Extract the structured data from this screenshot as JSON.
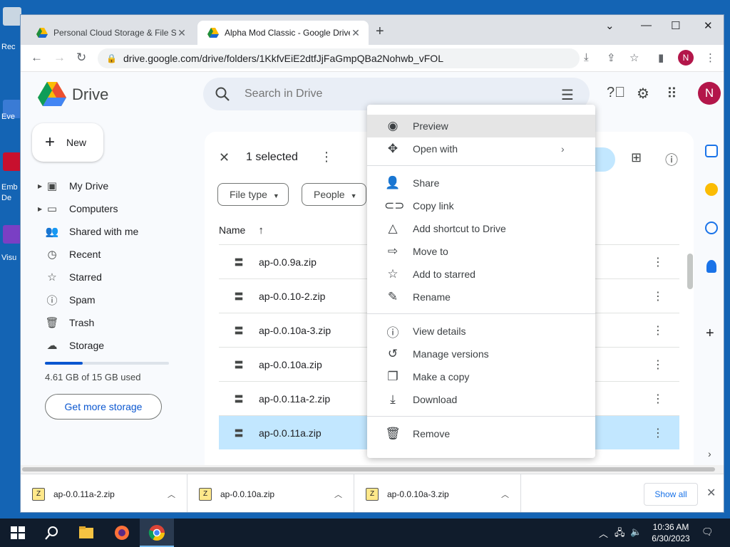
{
  "browser": {
    "tabs": [
      {
        "title": "Personal Cloud Storage & File Sh",
        "active": false
      },
      {
        "title": "Alpha Mod Classic - Google Drive",
        "active": true
      }
    ],
    "url": "drive.google.com/drive/folders/1KkfvEiE2dtfJjFaGmpQBa2Nohwb_vFOL",
    "profile_initial": "N"
  },
  "drive": {
    "app_name": "Drive",
    "search_placeholder": "Search in Drive",
    "new_label": "New",
    "profile_initial": "N",
    "nav": [
      {
        "label": "My Drive",
        "icon": "my-drive-icon",
        "expandable": true
      },
      {
        "label": "Computers",
        "icon": "computer-icon",
        "expandable": true
      },
      {
        "label": "Shared with me",
        "icon": "people-icon",
        "expandable": false
      },
      {
        "label": "Recent",
        "icon": "clock-icon",
        "expandable": false
      },
      {
        "label": "Starred",
        "icon": "star-icon",
        "expandable": false
      },
      {
        "label": "Spam",
        "icon": "spam-icon",
        "expandable": false
      },
      {
        "label": "Trash",
        "icon": "trash-icon",
        "expandable": false
      },
      {
        "label": "Storage",
        "icon": "cloud-icon",
        "expandable": false
      }
    ],
    "storage": {
      "used_text": "4.61 GB of 15 GB used",
      "used_fraction": 0.307,
      "button_label": "Get more storage"
    },
    "selection": {
      "text": "1 selected"
    },
    "filters": [
      "File type",
      "People"
    ],
    "column_name": "Name",
    "files": [
      {
        "name": "ap-0.0.9a.zip",
        "selected": false
      },
      {
        "name": "ap-0.0.10-2.zip",
        "selected": false
      },
      {
        "name": "ap-0.0.10a-3.zip",
        "selected": false
      },
      {
        "name": "ap-0.0.10a.zip",
        "selected": false
      },
      {
        "name": "ap-0.0.11a-2.zip",
        "selected": false
      },
      {
        "name": "ap-0.0.11a.zip",
        "selected": true
      }
    ]
  },
  "context_menu": {
    "groups": [
      [
        {
          "label": "Preview",
          "icon": "eye-icon",
          "hover": true
        },
        {
          "label": "Open with",
          "icon": "open-with-icon",
          "submenu": true
        }
      ],
      [
        {
          "label": "Share",
          "icon": "share-person-icon"
        },
        {
          "label": "Copy link",
          "icon": "link-icon"
        },
        {
          "label": "Add shortcut to Drive",
          "icon": "add-shortcut-icon"
        },
        {
          "label": "Move to",
          "icon": "move-to-icon"
        },
        {
          "label": "Add to starred",
          "icon": "star-icon"
        },
        {
          "label": "Rename",
          "icon": "pencil-icon"
        }
      ],
      [
        {
          "label": "View details",
          "icon": "info-icon"
        },
        {
          "label": "Manage versions",
          "icon": "history-icon"
        },
        {
          "label": "Make a copy",
          "icon": "copy-icon"
        },
        {
          "label": "Download",
          "icon": "download-icon"
        }
      ],
      [
        {
          "label": "Remove",
          "icon": "trash-icon"
        }
      ]
    ]
  },
  "downloads": {
    "items": [
      "ap-0.0.11a-2.zip",
      "ap-0.0.10a.zip",
      "ap-0.0.10a-3.zip"
    ],
    "show_all_label": "Show all"
  },
  "taskbar": {
    "time": "10:36 AM",
    "date": "6/30/2023"
  },
  "desktop": {
    "labels": [
      "Rec",
      "Eve",
      "Emb",
      "De",
      "Visu"
    ]
  },
  "colors": {
    "accent": "#0b57d0",
    "selected_row": "#c2e7ff",
    "profile": "#b3164a"
  }
}
